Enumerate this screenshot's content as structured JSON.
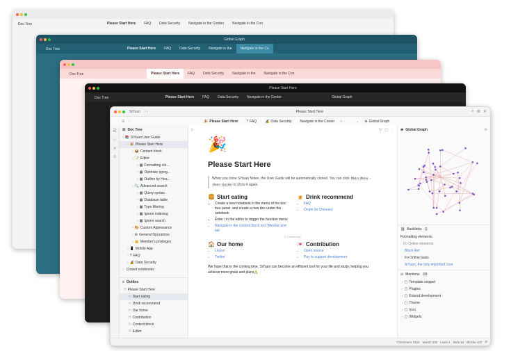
{
  "app_name": "SiYuan",
  "window_title": "Please Start Here",
  "bg_windows": {
    "w1": {
      "tabs": [
        "Please Start Here",
        "FAQ",
        "Data Security",
        "Navigate in the Conten",
        "Navigate in the Con"
      ],
      "sidebar_title": "Doc Tree"
    },
    "w2": {
      "tabs": [
        "Please Start Here",
        "FAQ",
        "Data Security",
        "Navigate in the",
        "Navigate in the Co"
      ],
      "sidebar_title": "Doc Tree",
      "title": "Global Graph"
    },
    "w3": {
      "tabs": [
        "Please Start Here",
        "FAQ",
        "Data Security",
        "Navigate in the",
        "Navigate in the Con"
      ],
      "sidebar_title": "Doc Tree"
    },
    "w4": {
      "tabs": [
        "Please Start Here",
        "FAQ",
        "Data Security",
        "Navigate in the Conter",
        "Global Graph"
      ],
      "sidebar_title": "Doc Tree",
      "title": "Please Start Here"
    }
  },
  "tabs": [
    {
      "label": "Please Start Here",
      "icon": "🎉"
    },
    {
      "label": "FAQ",
      "icon": "?"
    },
    {
      "label": "Data Security",
      "icon": "🔏"
    },
    {
      "label": "Navigate in the Conter",
      "icon": ""
    },
    {
      "label": "Global Graph",
      "icon": "⊛"
    }
  ],
  "doc_tree": {
    "title": "Doc Tree",
    "items": [
      {
        "label": "SiYuan User Guide",
        "depth": 0,
        "icon": "📚"
      },
      {
        "label": "Please Start Here",
        "depth": 1,
        "icon": "🎉",
        "selected": true
      },
      {
        "label": "Content block",
        "depth": 2,
        "icon": "📦"
      },
      {
        "label": "Editor",
        "depth": 2,
        "icon": "📝"
      },
      {
        "label": "Formatting ele...",
        "depth": 3,
        "icon": "▦"
      },
      {
        "label": "Optimize typog...",
        "depth": 3,
        "icon": "▦"
      },
      {
        "label": "Outline by Hea...",
        "depth": 3,
        "icon": "▦"
      },
      {
        "label": "Advanced search",
        "depth": 2,
        "icon": "🔍"
      },
      {
        "label": "Query syntax",
        "depth": 3,
        "icon": "▦"
      },
      {
        "label": "Database table",
        "depth": 3,
        "icon": "▦"
      },
      {
        "label": "Type filtering",
        "depth": 3,
        "icon": "▦"
      },
      {
        "label": "Ignore indexing",
        "depth": 3,
        "icon": "▦"
      },
      {
        "label": "Ignore search",
        "depth": 3,
        "icon": "▦"
      },
      {
        "label": "Custom Appearance",
        "depth": 2,
        "icon": "🎨"
      },
      {
        "label": "General Operations",
        "depth": 2,
        "icon": "⚙"
      },
      {
        "label": "Member's privileges",
        "depth": 2,
        "icon": "👑"
      },
      {
        "label": "Mobile App",
        "depth": 1,
        "icon": "📱"
      },
      {
        "label": "FAQ",
        "depth": 1,
        "icon": "?"
      },
      {
        "label": "Data Security",
        "depth": 1,
        "icon": "🔏"
      },
      {
        "label": "Closed notebooks",
        "depth": 0,
        "icon": ""
      }
    ]
  },
  "outline": {
    "title": "Outline",
    "items": [
      {
        "label": "Please Start Here",
        "depth": 0,
        "selected": false
      },
      {
        "label": "Start eating",
        "depth": 1,
        "selected": true
      },
      {
        "label": "Drink recommend",
        "depth": 1
      },
      {
        "label": "Our home",
        "depth": 1
      },
      {
        "label": "Contribution",
        "depth": 1
      },
      {
        "label": "Content block",
        "depth": 1
      },
      {
        "label": "Editor",
        "depth": 1
      }
    ]
  },
  "editor": {
    "breadcrumb": "▷",
    "title": "Please Start Here",
    "intro": "When you clone SiYuan Notes, the User Guide will be automatically cloned. You can click",
    "intro_kbd1": "Main Menu",
    "intro_kbd2": "User Guide",
    "intro_end": "to show it again.",
    "sections": {
      "start_eating": {
        "heading": "Start eating",
        "icon": "🍔",
        "items": [
          "Create a new notebook in the menu of the doc tree panel, and create a new doc under the notebook",
          "Enter / in the editor to trigger the function menu",
          "Navigate in the content block and Window and tab"
        ]
      },
      "drink": {
        "heading": "Drink recommend",
        "icon": "🍺",
        "items": [
          "FAQ",
          "Origin (in Chinese)"
        ]
      },
      "home": {
        "heading": "Our home",
        "icon": "🏠",
        "items": [
          "Liuyun",
          "Twitter"
        ]
      },
      "contribution": {
        "heading": "Contribution",
        "icon": "💌",
        "items": [
          "Open source",
          "Pay to support development"
        ]
      }
    },
    "community_label": "0 Community",
    "footer_text": "We hope that in the coming time, SiYuan can become an efficient tool for your life and study, helping you achieve more goals and plans🙏"
  },
  "right_panel": {
    "graph_title": "Global Graph",
    "backlinks_label": "Backlinks",
    "backlinks_count": "1",
    "backlinks": [
      {
        "label": "Formatting elements",
        "sub": "Fo Online elements"
      },
      {
        "label": "Block Ref",
        "sub": ""
      },
      {
        "label": "Fo Online basis",
        "sub": ""
      },
      {
        "label": "SiYuan, the only important core",
        "sub": ""
      }
    ],
    "mentions_label": "Mentions",
    "mentions_count": "10",
    "mentions": [
      "Template snippet",
      "Plugins",
      "Extend development",
      "Theme",
      "Icon",
      "Widgets"
    ]
  },
  "status": {
    "characters": "Characters 1625",
    "words": "Words 336",
    "lines": "Lines 4",
    "refs": "Refs 34",
    "blocks": "Blocks 122"
  },
  "colors": {
    "accent_link": "#4a7fd6",
    "graph_node": "#7a55c7",
    "graph_edge": "#e8a0a0"
  }
}
